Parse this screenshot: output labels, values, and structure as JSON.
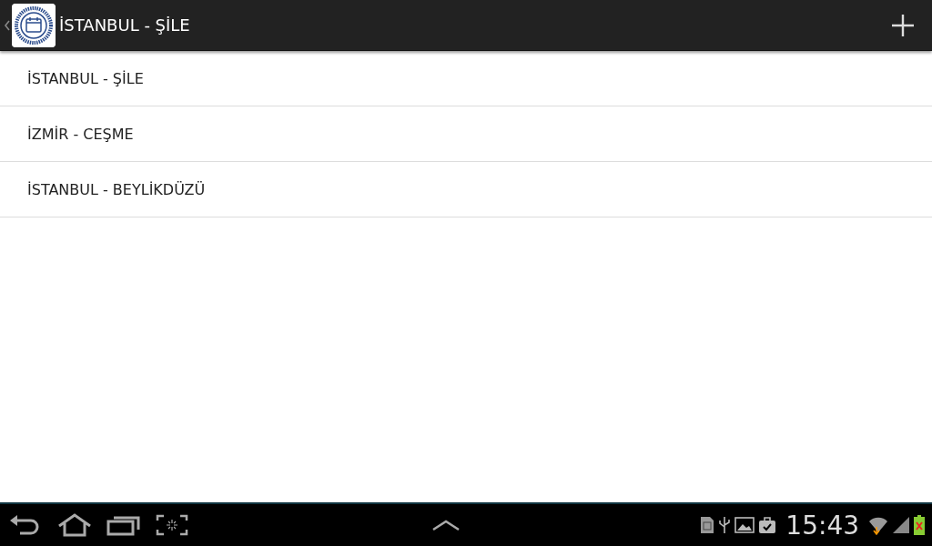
{
  "action_bar": {
    "title": "İSTANBUL - ŞİLE"
  },
  "list": [
    {
      "label": "İSTANBUL - ŞİLE"
    },
    {
      "label": "İZMİR - CEŞME"
    },
    {
      "label": "İSTANBUL - BEYLİKDÜZÜ"
    }
  ],
  "status_bar": {
    "time": "15:43"
  }
}
